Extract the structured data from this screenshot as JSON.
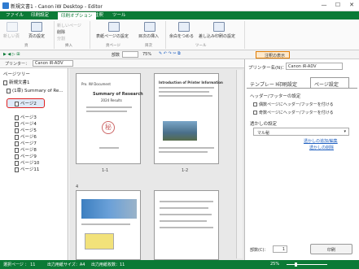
{
  "window": {
    "title": "新規文書1 - Canon iW Desktop - Editor",
    "min": "—",
    "max": "☐",
    "close": "✕"
  },
  "ribbon_tabs": [
    "ファイル",
    "印刷設定",
    "印刷オプション",
    "注釈",
    "ツール"
  ],
  "ribbon": {
    "new_page": "新しい頁",
    "page_settings": "頁の設定",
    "new_page2": "新しいページ",
    "delete": "削除",
    "split": "分割",
    "group_page": "頁",
    "group_insert": "挿入",
    "page_range": "表紙ページの設定",
    "insert_toc": "目次の挿入",
    "group_pages": "頁ページ",
    "group_toc": "目次",
    "sheets_merge": "余白をつめる",
    "sheet_settings": "差し込み印刷の設定",
    "group_tool": "ツール"
  },
  "toolbar": {
    "pages_label": "部数",
    "zoom": "75%",
    "view_btn": "注釈の表示"
  },
  "printer": {
    "label": "プリンター：",
    "value": "Canon iR-ADV"
  },
  "tree": {
    "title": "ページツリー",
    "root": "新規文書1",
    "chapter": "(1章) Summary of Re...",
    "pages": [
      "ページ2",
      "ページ3",
      "ページ4",
      "ページ5",
      "ページ6",
      "ページ7",
      "ページ8",
      "ページ9",
      "ページ10",
      "ページ11"
    ]
  },
  "pages": {
    "p1_header": "Pro. IW Document",
    "p1_title": "Summary of Research",
    "p1_sub": "2024 Results",
    "p1_seal": "秘",
    "p2_title": "Introduction of Printer Information",
    "label1": "1-1",
    "label2": "1-2",
    "label3": "4",
    "label4": ""
  },
  "right": {
    "printer_label": "プリンター名(N)：",
    "printer_value": "Canon iR-ADV",
    "tabs": [
      "テンプレート",
      "印刷設定",
      "ページ設定"
    ],
    "hf_section": "ヘッダー/フッターの設定",
    "hf_even": "偶数ページにヘッダー/フッターを付ける",
    "hf_odd": "奇数ページにヘッダー/フッターを付ける",
    "wm_section": "透かしの設定",
    "wm_value": "マル秘",
    "wm_link1": "透かしの追加/編集",
    "wm_link2": "透かしの削除",
    "copies_label": "部数(C)：",
    "copies_value": "1",
    "print_button": "印刷"
  },
  "status": {
    "pages": "選択ページ ： 11",
    "paper": "出力用紙サイズ：A4",
    "count": "出力用紙枚数：11",
    "zoom": "25%"
  }
}
